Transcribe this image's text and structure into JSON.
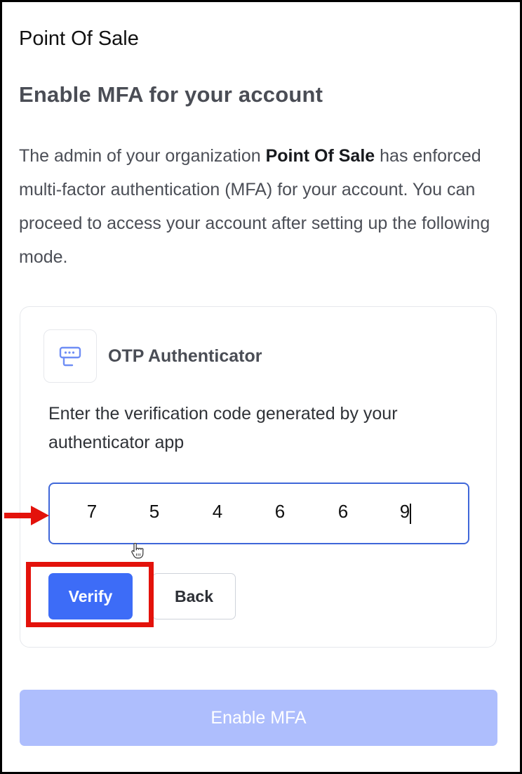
{
  "app": {
    "name": "Point Of Sale"
  },
  "page": {
    "title": "Enable MFA for your account",
    "intro_before": "The admin of your organization ",
    "intro_org": "Point Of Sale",
    "intro_after": " has enforced multi-factor authentication (MFA) for your account. You can proceed to access your account after setting up the following mode."
  },
  "mfa_method": {
    "icon": "otp-authenticator-icon",
    "title": "OTP Authenticator",
    "instruction": "Enter the verification code generated by your authenticator app",
    "code_digits": [
      "7",
      "5",
      "4",
      "6",
      "6",
      "9"
    ],
    "verify_label": "Verify",
    "back_label": "Back"
  },
  "footer": {
    "enable_label": "Enable MFA",
    "enabled": false
  },
  "annotations": {
    "highlight_color": "#e3120b",
    "arrow_color": "#e3120b"
  },
  "colors": {
    "primary": "#3d6cf7",
    "primary_disabled": "#aebefd",
    "input_border": "#3f67d9"
  }
}
